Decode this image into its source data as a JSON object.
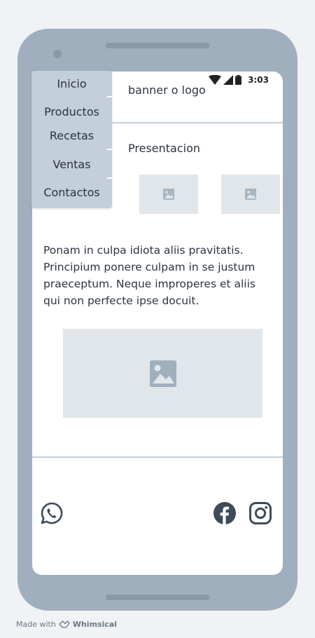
{
  "status_bar": {
    "time": "3:03"
  },
  "nav": {
    "items": [
      {
        "label": "Inicio"
      },
      {
        "label": "Productos"
      },
      {
        "label": "Recetas"
      },
      {
        "label": "Ventas"
      },
      {
        "label": "Contactos"
      }
    ]
  },
  "header": {
    "banner_text": "banner o logo"
  },
  "presentation": {
    "title": "Presentacion"
  },
  "body_text": "Ponam in culpa idiota aliis pravitatis. Principium ponere culpam in se justum praeceptum. Neque improperes et aliis qui non perfecte ipse docuit.",
  "footer": {
    "social_icons": [
      "whatsapp-icon",
      "facebook-icon",
      "instagram-icon"
    ]
  },
  "credit": {
    "prefix": "Made with",
    "brand": "Whimsical"
  },
  "colors": {
    "phone_frame": "#9fafbd",
    "nav_bg": "#c3cfd9",
    "placeholder": "#e1e6ea",
    "placeholder_icon": "#9fafbd",
    "social_icon": "#3e4c59"
  }
}
